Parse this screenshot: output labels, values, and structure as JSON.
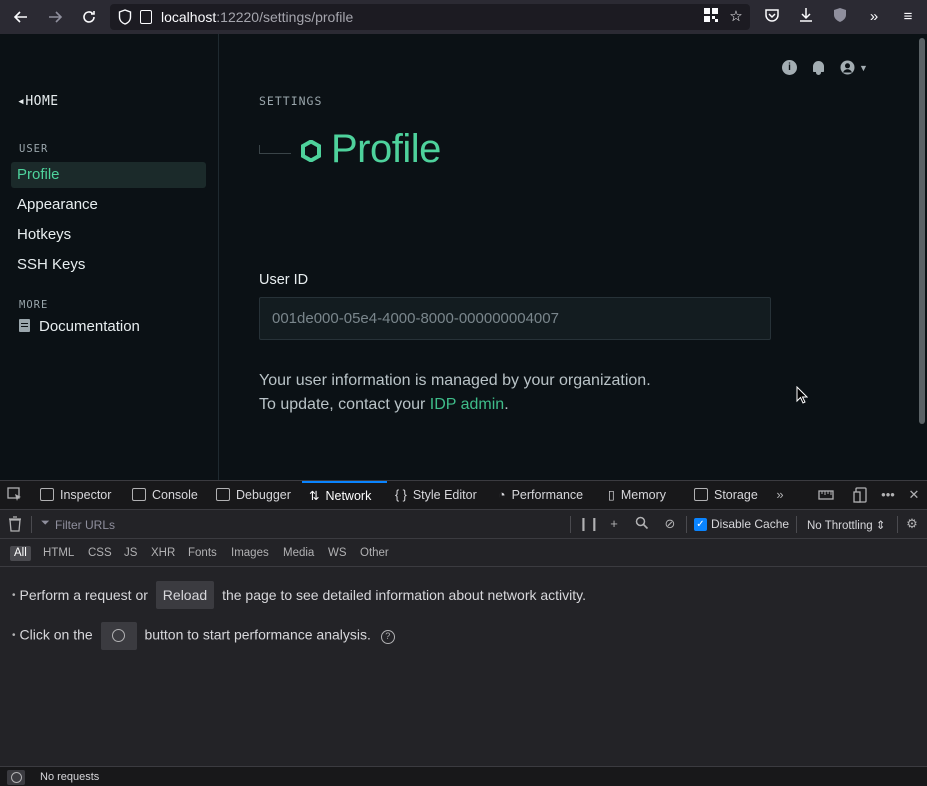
{
  "browser": {
    "url_host": "localhost",
    "url_rest": ":12220/settings/profile"
  },
  "sidebar": {
    "home_label": "◂HOME",
    "user_section": "USER",
    "items": [
      {
        "label": "Profile"
      },
      {
        "label": "Appearance"
      },
      {
        "label": "Hotkeys"
      },
      {
        "label": "SSH Keys"
      }
    ],
    "more_section": "MORE",
    "documentation_label": "Documentation"
  },
  "main": {
    "breadcrumb": "SETTINGS",
    "title": "Profile",
    "user_id_label": "User ID",
    "user_id_value": "001de000-05e4-4000-8000-000000004007",
    "info_line1": "Your user information is managed by your organization.",
    "info_line2_prefix": "To update, contact your ",
    "info_link": "IDP admin",
    "info_line2_suffix": "."
  },
  "devtools": {
    "tabs": [
      {
        "label": "Inspector"
      },
      {
        "label": "Console"
      },
      {
        "label": "Debugger"
      },
      {
        "label": "Network"
      },
      {
        "label": "Style Editor"
      },
      {
        "label": "Performance"
      },
      {
        "label": "Memory"
      },
      {
        "label": "Storage"
      }
    ],
    "filter_placeholder": "Filter URLs",
    "disable_cache_label": "Disable Cache",
    "throttling_label": "No Throttling",
    "filters": [
      "All",
      "HTML",
      "CSS",
      "JS",
      "XHR",
      "Fonts",
      "Images",
      "Media",
      "WS",
      "Other"
    ],
    "msg1_prefix": "Perform a request or",
    "reload_label": "Reload",
    "msg1_suffix": "the page to see detailed information about network activity.",
    "msg2_prefix": "Click on the",
    "msg2_suffix": "button to start performance analysis.",
    "status": "No requests"
  },
  "colors": {
    "accent_green": "#4ed29c",
    "page_bg": "#0b1115",
    "devtools_active_tab": "#0a84ff"
  }
}
